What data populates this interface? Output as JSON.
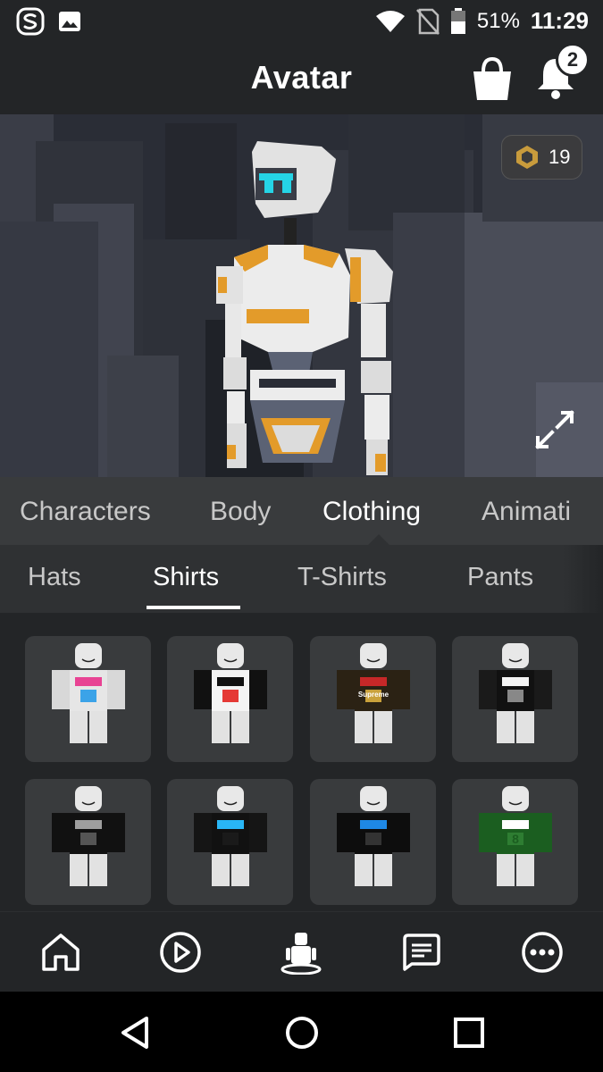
{
  "status_bar": {
    "left_icons": [
      "app-s-icon",
      "image-icon"
    ],
    "right_icons": [
      "wifi-icon",
      "no-sim-icon",
      "battery-icon"
    ],
    "battery": "51%",
    "time": "11:29"
  },
  "header": {
    "title": "Avatar",
    "shop_icon": "shopping-bag-icon",
    "bell_icon": "bell-icon",
    "notification_count": "2"
  },
  "scene": {
    "robux_icon": "robux-icon",
    "robux_balance": "19",
    "expand_icon": "expand-icon"
  },
  "category_tabs": [
    {
      "label": "Characters",
      "active": false
    },
    {
      "label": "Body",
      "active": false
    },
    {
      "label": "Clothing",
      "active": true
    },
    {
      "label": "Animati",
      "active": false
    }
  ],
  "sub_tabs": [
    {
      "label": "Hats",
      "active": false
    },
    {
      "label": "Shirts",
      "active": true
    },
    {
      "label": "T-Shirts",
      "active": false
    },
    {
      "label": "Pants",
      "active": false
    }
  ],
  "items": [
    {
      "name": "rainbow-tie-dye-shirt",
      "torso": "#e6e6e6",
      "accent": "#e84393",
      "accent2": "#3ba3e8",
      "arms": "#d8d8d8"
    },
    {
      "name": "white-black-split-shirt",
      "torso": "#f4f4f4",
      "accent": "#111111",
      "accent2": "#e53935",
      "arms": "#111111"
    },
    {
      "name": "supreme-pattern-shirt",
      "torso": "#2b2214",
      "accent": "#c62828",
      "accent2": "#c9a13b",
      "arms": "#2b2214",
      "label": "Supreme"
    },
    {
      "name": "marshmello-shirt",
      "torso": "#111111",
      "accent": "#f4f4f4",
      "accent2": "#888888",
      "arms": "#1a1a1a"
    },
    {
      "name": "jurassic-black-shirt",
      "torso": "#111111",
      "accent": "#9e9e9e",
      "accent2": "#555555",
      "arms": "#111111"
    },
    {
      "name": "blue-collar-black-shirt",
      "torso": "#111111",
      "accent": "#29b6f6",
      "accent2": "#1a1a1a",
      "arms": "#151515"
    },
    {
      "name": "blue-shirt-black-jacket",
      "torso": "#0d0d0d",
      "accent": "#1e88e5",
      "accent2": "#333333",
      "arms": "#0d0d0d"
    },
    {
      "name": "green-jersey-8-shirt",
      "torso": "#1b5e20",
      "accent": "#ffffff",
      "accent2": "#2e7d32",
      "arms": "#1b5e20",
      "label": "8"
    }
  ],
  "bottom_nav": [
    {
      "name": "home",
      "icon": "home-icon",
      "active": false
    },
    {
      "name": "discover",
      "icon": "play-icon",
      "active": false
    },
    {
      "name": "avatar",
      "icon": "avatar-icon",
      "active": true
    },
    {
      "name": "chat",
      "icon": "chat-icon",
      "active": false
    },
    {
      "name": "more",
      "icon": "more-icon",
      "active": false
    }
  ],
  "system_nav": {
    "back_icon": "back-icon",
    "home_icon": "home-circle-icon",
    "recents_icon": "recents-icon"
  },
  "colors": {
    "background": "#232527",
    "tab_bar": "#393b3d",
    "subtab_bar": "#2f3133",
    "item_tile": "#393b3d",
    "accent_orange": "#e39b2a"
  }
}
